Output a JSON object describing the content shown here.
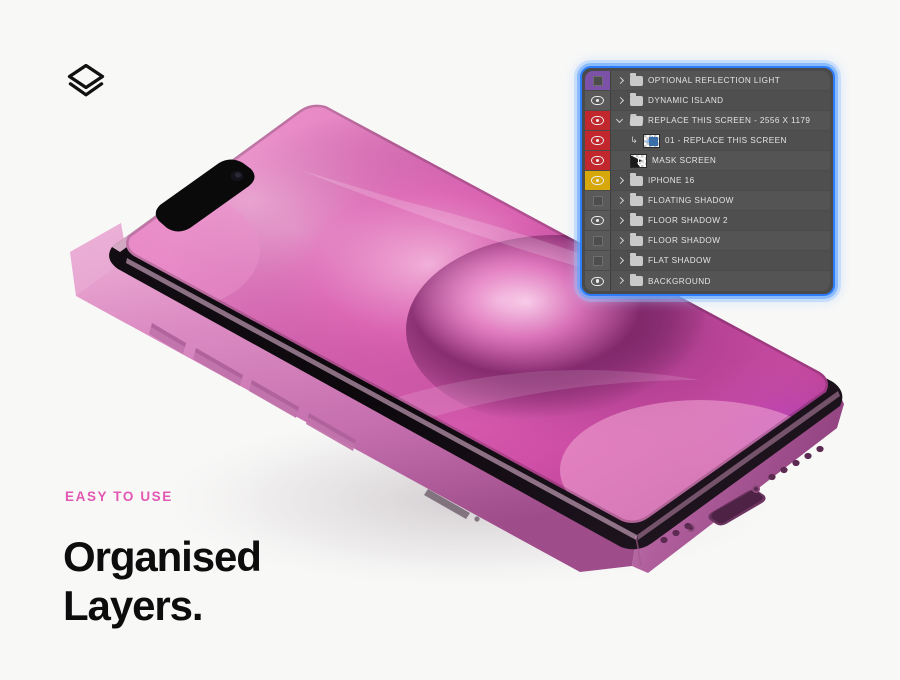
{
  "brand": {
    "logo_icon": "layers-stack-icon"
  },
  "copy": {
    "eyebrow": "EASY TO USE",
    "headline_line1": "Organised",
    "headline_line2": "Layers.",
    "accent_color": "#e258b2",
    "headline_color": "#0d0d0d",
    "background_color": "#f8f8f7"
  },
  "device": {
    "name": "iPhone 16",
    "body_color": "#d98ec4",
    "screen_colors": [
      "#f2a8d0",
      "#e05fae",
      "#8e2e77",
      "#c2view"
    ],
    "dynamic_island_color": "#0b0b0b"
  },
  "layers_panel": {
    "highlight_color": "#2d7dfa",
    "panel_background": "#4a4a4a",
    "row_background": "#545454",
    "layers": [
      {
        "name": "OPTIONAL REFLECTION LIGHT",
        "visible": false,
        "label_color": "purple",
        "kind": "folder",
        "expanded": false,
        "indented": false,
        "clipped": false,
        "underline": false
      },
      {
        "name": "DYNAMIC ISLAND",
        "visible": true,
        "label_color": "none",
        "kind": "folder",
        "expanded": false,
        "indented": false,
        "clipped": false,
        "underline": false
      },
      {
        "name": "REPLACE THIS SCREEN - 2556 X 1179",
        "visible": true,
        "label_color": "red",
        "kind": "folder-open",
        "expanded": true,
        "indented": false,
        "clipped": false,
        "underline": false
      },
      {
        "name": "01 - REPLACE THIS SCREEN",
        "visible": true,
        "label_color": "red",
        "kind": "thumbnail",
        "expanded": false,
        "indented": true,
        "clipped": true,
        "underline": false
      },
      {
        "name": "MASK SCREEN",
        "visible": true,
        "label_color": "red",
        "kind": "thumbnail-mask",
        "expanded": false,
        "indented": true,
        "clipped": false,
        "underline": true
      },
      {
        "name": "IPHONE 16",
        "visible": true,
        "label_color": "yellow",
        "kind": "folder",
        "expanded": false,
        "indented": false,
        "clipped": false,
        "underline": false
      },
      {
        "name": "FLOATING SHADOW",
        "visible": false,
        "label_color": "none",
        "kind": "folder",
        "expanded": false,
        "indented": false,
        "clipped": false,
        "underline": false
      },
      {
        "name": "FLOOR SHADOW 2",
        "visible": true,
        "label_color": "none",
        "kind": "folder",
        "expanded": false,
        "indented": false,
        "clipped": false,
        "underline": false
      },
      {
        "name": "FLOOR SHADOW",
        "visible": false,
        "label_color": "none",
        "kind": "folder",
        "expanded": false,
        "indented": false,
        "clipped": false,
        "underline": false
      },
      {
        "name": "FLAT SHADOW",
        "visible": false,
        "label_color": "none",
        "kind": "folder",
        "expanded": false,
        "indented": false,
        "clipped": false,
        "underline": false
      },
      {
        "name": "BACKGROUND",
        "visible": true,
        "label_color": "none",
        "kind": "folder",
        "expanded": false,
        "indented": false,
        "clipped": false,
        "underline": false
      }
    ]
  }
}
